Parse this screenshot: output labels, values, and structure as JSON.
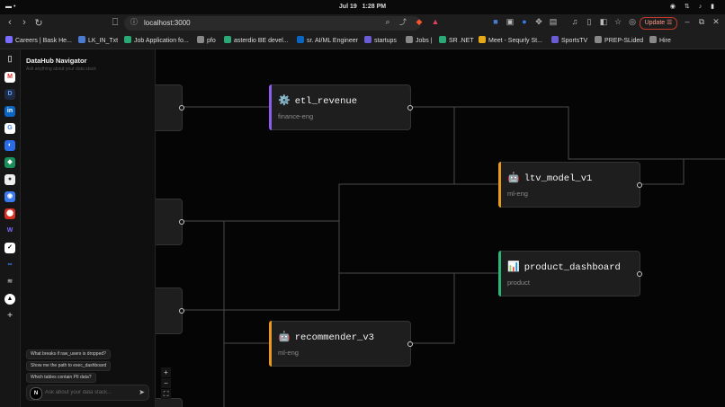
{
  "system": {
    "date": "Jul 19",
    "time": "1:28 PM"
  },
  "browser": {
    "url": "localhost:3000",
    "update_label": "Update",
    "bookmarks": [
      {
        "label": "Careers | Bask He...",
        "color": "#7a6cff"
      },
      {
        "label": "LK_IN_Txt",
        "color": "#4a7bd0"
      },
      {
        "label": "Job Application fo...",
        "color": "#2aa876"
      },
      {
        "label": "pfo",
        "color": "#888888"
      },
      {
        "label": "asterdio BE devel...",
        "color": "#2aa876"
      },
      {
        "label": "sr. AI/ML Engineer",
        "color": "#0a66c2"
      },
      {
        "label": "startups",
        "color": "#6b5bd6"
      },
      {
        "label": "Jobs |",
        "color": "#888888"
      },
      {
        "label": "SR .NET",
        "color": "#2aa876"
      },
      {
        "label": "Meet - Sequrly St...",
        "color": "#e6a817"
      },
      {
        "label": "SportsTV",
        "color": "#6b5bd6"
      },
      {
        "label": "PREP-SLided",
        "color": "#888888"
      },
      {
        "label": "Hire",
        "color": "#888888"
      }
    ]
  },
  "panel": {
    "title": "DataHub Navigator",
    "subtitle": "Ask anything about your data stack",
    "suggestions": [
      "What breaks if raw_users is dropped?",
      "Show me the path to exec_dashboard",
      "Which tables contain PII data?"
    ],
    "input_placeholder": "Ask about your data stack...",
    "avatar_letter": "N"
  },
  "graph": {
    "nodes": [
      {
        "id": "etl_revenue",
        "icon": "gear-icon",
        "emoji": "⚙️",
        "name": "etl_revenue",
        "owner": "finance-eng",
        "accent": "#8e5cf0"
      },
      {
        "id": "ltv_model_v1",
        "icon": "robot-icon",
        "emoji": "🤖",
        "name": "ltv_model_v1",
        "owner": "ml-eng",
        "accent": "#e89a1c"
      },
      {
        "id": "product_dashboard",
        "icon": "bar-chart-icon",
        "emoji": "📊",
        "name": "product_dashboard",
        "owner": "product",
        "accent": "#2bb673"
      },
      {
        "id": "recommender_v3",
        "icon": "robot-icon",
        "emoji": "🤖",
        "name": "recommender_v3",
        "owner": "ml-eng",
        "accent": "#e89a1c"
      }
    ],
    "controls": {
      "zoom_in": "+",
      "zoom_out": "−",
      "fit": "⛶"
    }
  }
}
